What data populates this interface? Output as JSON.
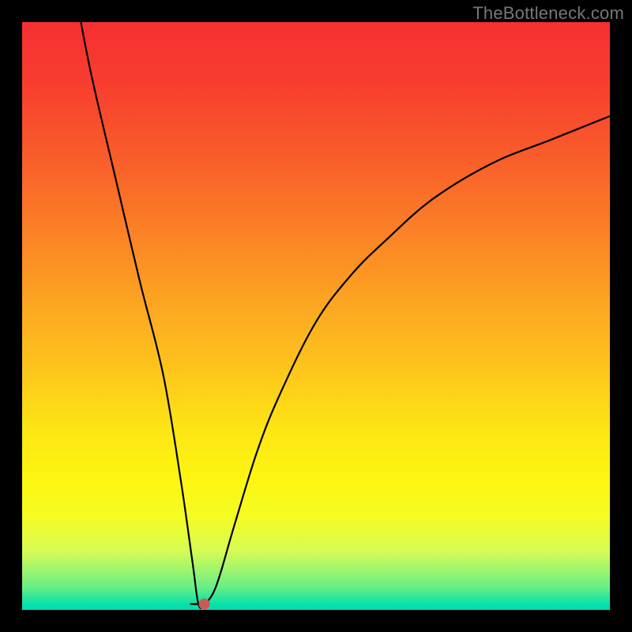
{
  "watermark": "TheBottleneck.com",
  "chart_data": {
    "type": "line",
    "title": "",
    "xlabel": "",
    "ylabel": "",
    "xlim": [
      0,
      100
    ],
    "ylim": [
      0,
      100
    ],
    "grid": false,
    "legend": false,
    "background_gradient": {
      "top_color": "#f72f32",
      "mid_color": "#fdc81b",
      "bottom_color": "#03dcb0"
    },
    "series": [
      {
        "name": "curve",
        "color": "#000000",
        "x": [
          10,
          12,
          16,
          20,
          24,
          27,
          29,
          30,
          31,
          33,
          36,
          40,
          44,
          50,
          56,
          62,
          70,
          80,
          90,
          100
        ],
        "values": [
          100,
          90,
          73,
          56,
          40,
          22,
          8,
          1,
          1,
          4,
          14,
          27,
          37,
          49,
          57,
          63,
          70,
          76,
          80,
          84
        ]
      }
    ],
    "marker": {
      "name": "min-point",
      "x": 31,
      "y": 1,
      "color": "#cc5a52",
      "radius_px": 7
    }
  }
}
